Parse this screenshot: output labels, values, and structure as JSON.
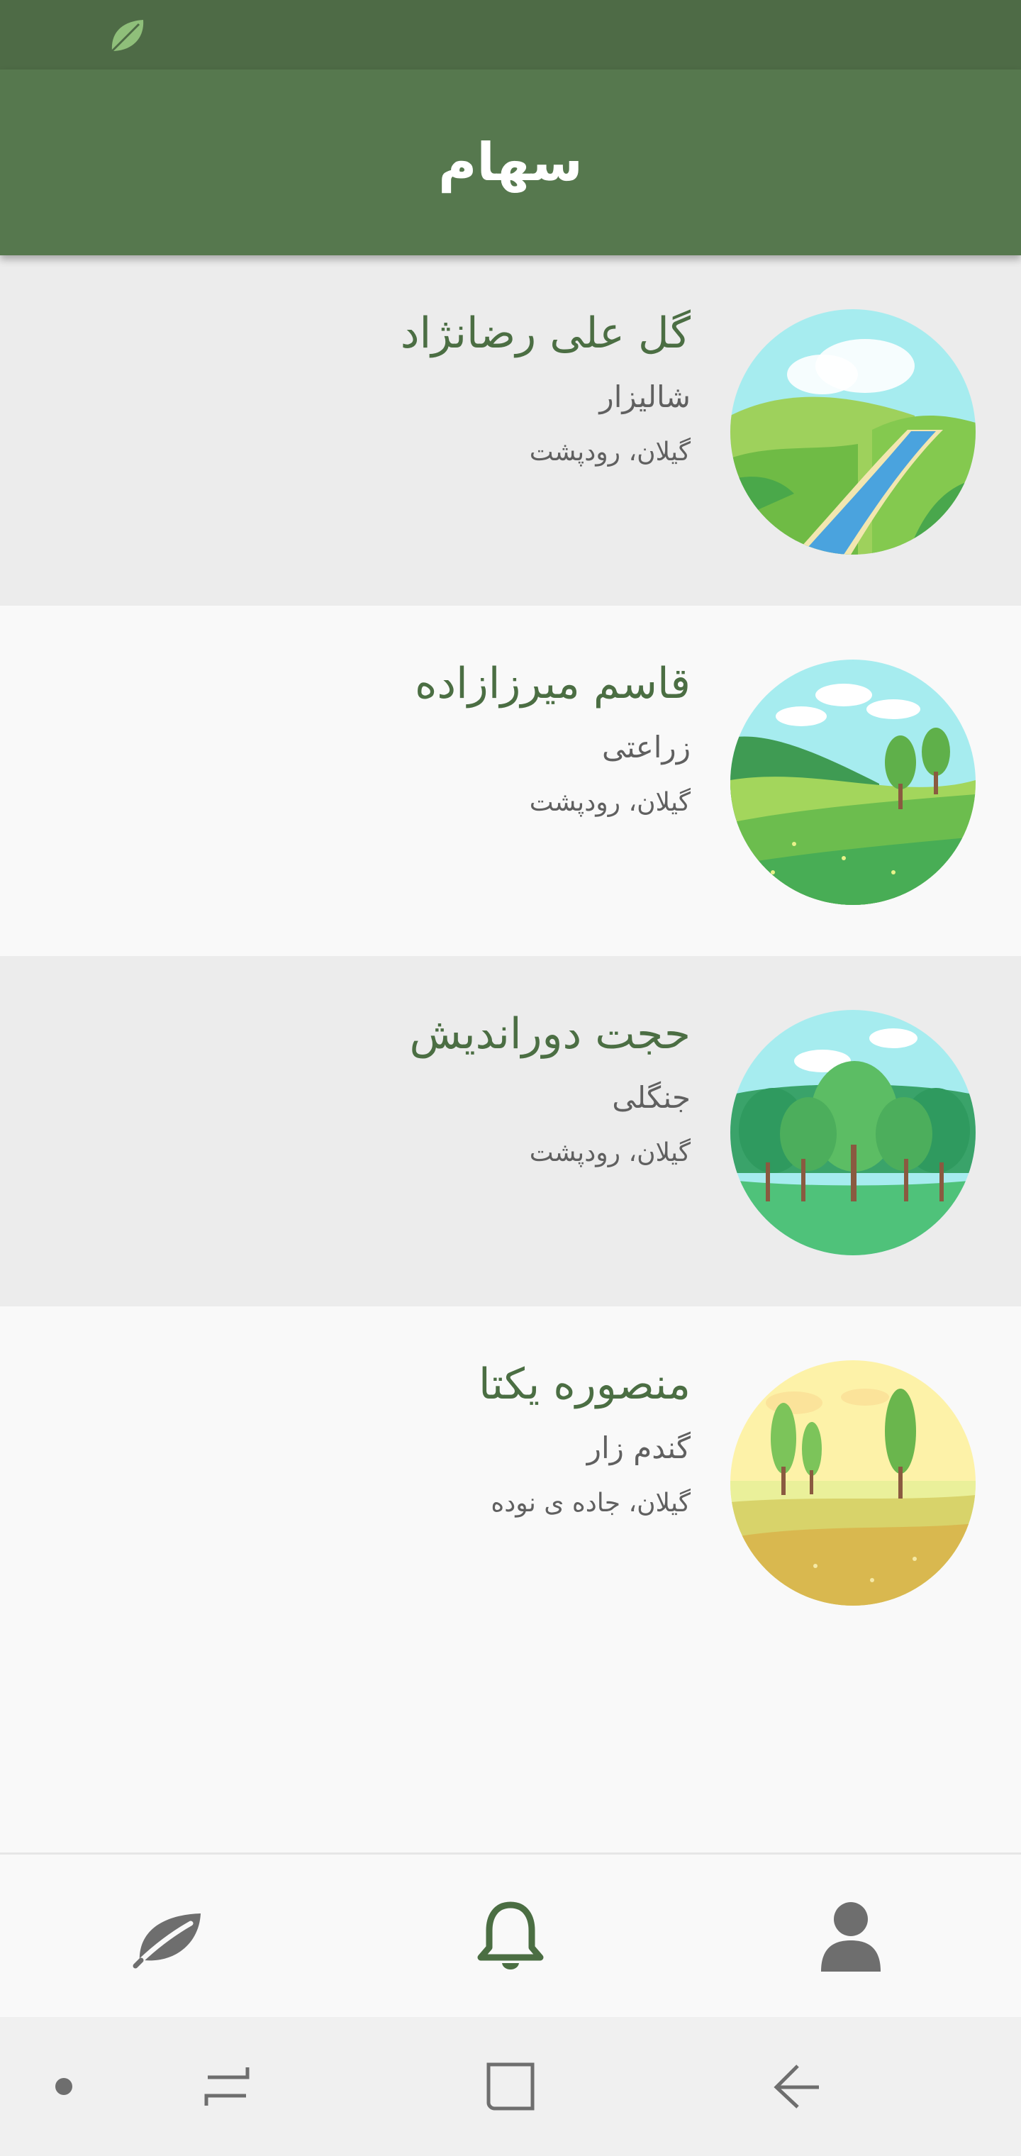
{
  "app": {
    "title": "سهام",
    "colors": {
      "status_bar": "#4e6b46",
      "app_bar": "#56784e",
      "accent": "#4b6e43",
      "row_shaded": "#ececec",
      "row_plain": "#f9f9f9"
    }
  },
  "status_bar": {
    "icon": "leaf-icon"
  },
  "farms": [
    {
      "name": "گل علی رضانژاد",
      "category": "شالیزار",
      "location": "گیلان، رودپشت",
      "image": "river-landscape"
    },
    {
      "name": "قاسم میرزازاده",
      "category": "زراعتی",
      "location": "گیلان، رودپشت",
      "image": "green-hills-landscape"
    },
    {
      "name": "حجت دوراندیش",
      "category": "جنگلی",
      "location": "گیلان، رودپشت",
      "image": "forest-landscape"
    },
    {
      "name": "منصوره یکتا",
      "category": "گندم زار",
      "location": "گیلان، جاده ی نوده",
      "image": "wheat-field-landscape"
    }
  ],
  "bottom_nav": {
    "items": [
      {
        "icon": "leaf-icon",
        "active": false
      },
      {
        "icon": "bell-icon",
        "active": true
      },
      {
        "icon": "user-icon",
        "active": false
      }
    ]
  },
  "system_nav": {
    "items": [
      "dot-icon",
      "recents-icon",
      "home-icon",
      "back-icon"
    ]
  }
}
